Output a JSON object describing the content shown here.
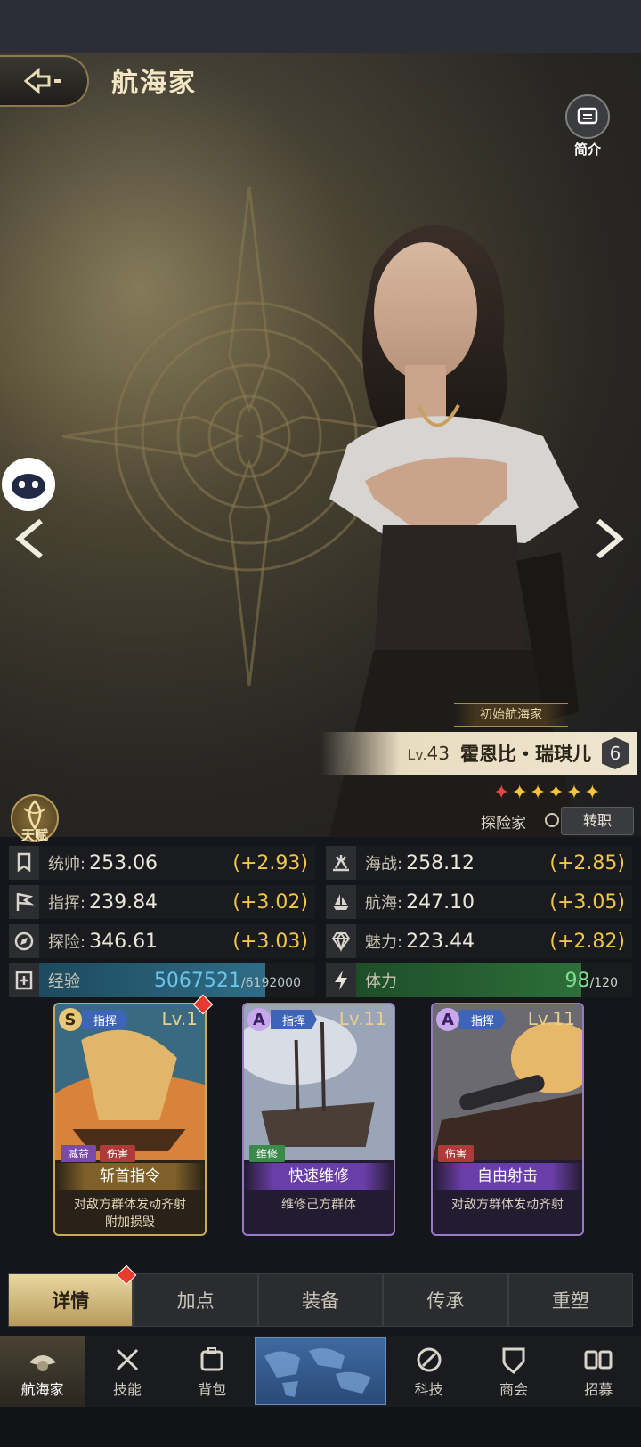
{
  "header": {
    "title": "航海家",
    "intro_label": "简介"
  },
  "hero": {
    "origin_badge": "初始航海家",
    "level_prefix": "Lv.",
    "level": "43",
    "name": "霍恩比・瑞琪儿",
    "rank": "6",
    "stars_red": "✦",
    "stars_gold": "✦✦✦✦✦",
    "class": "探险家",
    "change_job": "转职",
    "talent": "天赋"
  },
  "stats": {
    "left": [
      {
        "name": "统帅:",
        "value": "253.06",
        "bonus": "(+2.93)",
        "icon": "banner-icon"
      },
      {
        "name": "指挥:",
        "value": "239.84",
        "bonus": "(+3.02)",
        "icon": "flag-icon"
      },
      {
        "name": "探险:",
        "value": "346.61",
        "bonus": "(+3.03)",
        "icon": "compass-icon"
      }
    ],
    "right": [
      {
        "name": "海战:",
        "value": "258.12",
        "bonus": "(+2.85)",
        "icon": "cannon-icon"
      },
      {
        "name": "航海:",
        "value": "247.10",
        "bonus": "(+3.05)",
        "icon": "ship-icon"
      },
      {
        "name": "魅力:",
        "value": "223.44",
        "bonus": "(+2.82)",
        "icon": "diamond-icon"
      }
    ],
    "exp": {
      "label": "经验",
      "current": "5067521",
      "max": "/6192000",
      "fraction": 0.818
    },
    "stamina": {
      "label": "体力",
      "current": "98",
      "max": "/120",
      "fraction": 0.817
    }
  },
  "skills": [
    {
      "grade": "S",
      "type": "指挥",
      "level": "Lv.1",
      "tags": [
        "减益",
        "伤害"
      ],
      "title": "斩首指令",
      "desc1": "对敌方群体发动齐射",
      "desc2": "附加损毁",
      "new": true
    },
    {
      "grade": "A",
      "type": "指挥",
      "level": "Lv.11",
      "tags": [
        "维修"
      ],
      "title": "快速维修",
      "desc1": "维修己方群体",
      "desc2": "",
      "new": false
    },
    {
      "grade": "A",
      "type": "指挥",
      "level": "Lv.11",
      "tags": [
        "伤害"
      ],
      "title": "自由射击",
      "desc1": "对敌方群体发动齐射",
      "desc2": "",
      "new": false
    }
  ],
  "tabs": [
    "详情",
    "加点",
    "装备",
    "传承",
    "重塑"
  ],
  "nav": [
    "航海家",
    "技能",
    "背包",
    "科技",
    "商会",
    "招募"
  ],
  "colors": {
    "gold": "#f0c64a",
    "exp_blue": "#2f6c86",
    "stamina_green": "#2d6e3a",
    "accent": "#d8b66a"
  }
}
